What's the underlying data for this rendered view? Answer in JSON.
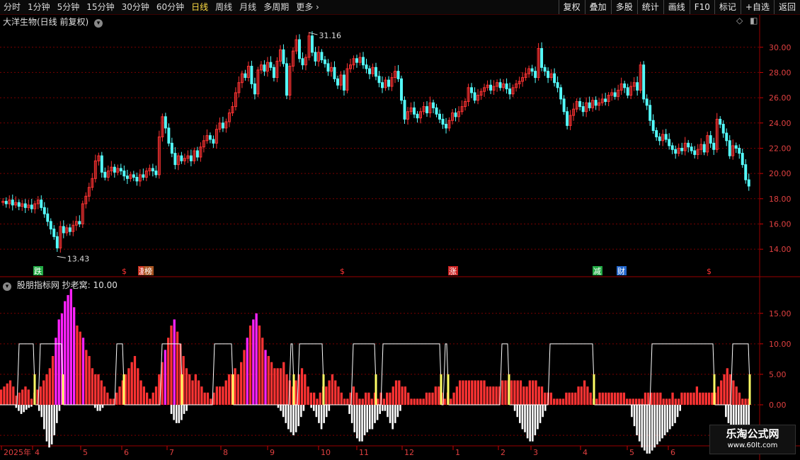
{
  "toolbar": {
    "tabs": [
      "分时",
      "1分钟",
      "5分钟",
      "15分钟",
      "30分钟",
      "60分钟",
      "日线",
      "周线",
      "月线",
      "多周期",
      "更多"
    ],
    "active_tab": "日线",
    "right_buttons": [
      "复权",
      "叠加",
      "多股",
      "统计",
      "画线",
      "F10",
      "标记",
      "+自选",
      "返回"
    ]
  },
  "main_panel": {
    "title": "大洋生物(日线 前复权)",
    "high_label": "31.16",
    "low_label": "13.43",
    "y_ticks": [
      "30.00",
      "28.00",
      "26.00",
      "24.00",
      "22.00",
      "20.00",
      "18.00",
      "16.00",
      "14.00"
    ],
    "event_tags": [
      {
        "text": "跌",
        "color": "#22aa44"
      },
      {
        "text": "$",
        "color": "#ff3333"
      },
      {
        "text": "激",
        "color": "#cc3322"
      },
      {
        "text": "榜",
        "color": "#aa5522"
      },
      {
        "text": "$",
        "color": "#ff3333"
      },
      {
        "text": "涨",
        "color": "#cc2222"
      },
      {
        "text": "减",
        "color": "#22aa44"
      },
      {
        "text": "财",
        "color": "#2266cc"
      },
      {
        "text": "$",
        "color": "#ff3333"
      }
    ]
  },
  "indicator_panel": {
    "title": "股朋指标网 抄老窝: 10.00",
    "y_ticks": [
      "15.00",
      "10.00",
      "5.00",
      "0.00",
      "-5.00"
    ]
  },
  "x_axis": {
    "labels": [
      "2025年",
      "4",
      "5",
      "6",
      "7",
      "8",
      "9",
      "10",
      "11",
      "12",
      "1",
      "2",
      "3",
      "4",
      "5",
      "6"
    ]
  },
  "watermark": {
    "line1": "乐淘公式网",
    "line2": "www.60lt.com"
  },
  "colors": {
    "up": "#ff3333",
    "down": "#54ffff",
    "grid": "#7a0000",
    "magenta": "#ff22ff",
    "yellow": "#ffff66"
  },
  "chart_data": {
    "type": "candlestick",
    "ylim": [
      13,
      31.5
    ],
    "close": [
      17.8,
      17.6,
      17.9,
      17.5,
      17.7,
      17.4,
      17.6,
      17.3,
      17.5,
      17.2,
      17.6,
      17.9,
      17.3,
      16.8,
      16.2,
      15.6,
      15.0,
      14.1,
      15.8,
      15.3,
      15.7,
      15.4,
      15.9,
      16.2,
      16.0,
      17.6,
      18.2,
      18.9,
      19.6,
      21.0,
      21.4,
      20.1,
      19.7,
      20.2,
      20.5,
      20.1,
      20.4,
      20.2,
      19.8,
      19.6,
      19.9,
      19.7,
      19.4,
      19.9,
      19.7,
      20.2,
      20.4,
      20.2,
      19.9,
      22.9,
      24.5,
      23.6,
      22.4,
      21.6,
      20.7,
      21.4,
      21.0,
      21.2,
      21.4,
      21.0,
      21.8,
      21.3,
      22.1,
      22.6,
      23.0,
      22.7,
      22.4,
      23.5,
      24.0,
      23.6,
      24.1,
      24.8,
      25.3,
      26.4,
      27.2,
      27.9,
      27.6,
      28.5,
      27.1,
      26.3,
      28.2,
      28.6,
      28.1,
      28.8,
      28.4,
      27.6,
      28.9,
      29.8,
      28.7,
      26.2,
      28.5,
      29.7,
      30.6,
      29.1,
      28.6,
      29.2,
      30.9,
      29.6,
      28.9,
      29.6,
      29.0,
      28.7,
      28.1,
      28.4,
      27.5,
      27.0,
      27.8,
      26.6,
      28.3,
      28.6,
      29.1,
      28.8,
      29.2,
      28.6,
      28.3,
      27.9,
      28.4,
      27.7,
      27.2,
      26.8,
      27.4,
      26.9,
      27.6,
      28.1,
      27.5,
      25.8,
      24.3,
      24.9,
      25.2,
      24.7,
      24.4,
      24.9,
      25.3,
      24.8,
      25.6,
      25.2,
      24.7,
      24.3,
      23.9,
      23.6,
      24.2,
      24.8,
      24.5,
      24.9,
      25.3,
      25.7,
      26.8,
      26.4,
      25.8,
      26.2,
      26.5,
      26.8,
      27.0,
      26.6,
      26.9,
      27.2,
      26.8,
      27.1,
      26.7,
      26.3,
      26.8,
      27.1,
      27.3,
      27.6,
      27.9,
      28.3,
      28.1,
      27.6,
      29.9,
      28.4,
      28.1,
      27.6,
      27.9,
      27.2,
      26.8,
      25.9,
      24.9,
      23.8,
      24.6,
      25.1,
      25.7,
      25.3,
      24.9,
      25.6,
      25.2,
      25.8,
      25.4,
      25.6,
      25.9,
      25.7,
      26.2,
      26.4,
      26.1,
      26.6,
      27.1,
      26.8,
      26.2,
      26.9,
      27.2,
      26.6,
      28.6,
      25.9,
      25.4,
      24.2,
      23.4,
      22.9,
      22.6,
      23.1,
      22.7,
      22.2,
      21.9,
      21.6,
      22.0,
      21.8,
      22.4,
      22.1,
      21.8,
      21.5,
      21.9,
      22.3,
      21.7,
      23.0,
      22.4,
      21.9,
      24.3,
      23.9,
      23.2,
      22.6,
      21.4,
      22.2,
      22.0,
      21.6,
      20.7,
      19.5,
      19.0
    ],
    "indicator": {
      "ylim": [
        -6.5,
        19.5
      ],
      "bars": [
        2.5,
        3,
        3.5,
        4,
        3,
        1.5,
        2,
        2.5,
        3,
        2.5,
        1,
        2,
        2.5,
        3,
        4,
        5,
        6,
        8,
        11,
        14,
        15,
        17,
        18,
        19,
        16,
        13,
        12,
        11,
        9,
        8,
        6,
        5,
        5,
        4,
        3,
        2,
        1,
        1,
        2,
        3,
        4,
        5,
        6,
        7,
        8,
        6,
        4,
        3,
        2,
        1,
        2,
        3,
        5,
        7,
        9,
        11,
        13,
        14,
        12,
        10,
        8,
        6,
        5,
        4,
        5,
        4,
        3,
        2,
        2,
        1,
        2,
        3,
        3,
        3,
        4,
        5,
        5,
        6,
        5,
        7,
        9,
        11,
        13,
        14,
        15,
        13,
        11,
        9,
        8,
        7,
        6,
        6,
        6,
        7,
        5,
        4,
        3,
        4,
        5,
        6,
        5,
        3,
        2,
        2,
        1,
        2,
        3,
        3,
        4,
        5,
        4,
        3,
        2,
        1,
        1,
        2,
        3,
        2,
        1,
        1,
        2,
        2,
        1,
        2,
        1,
        2,
        1,
        2,
        2,
        3,
        4,
        4,
        3,
        3,
        2,
        1,
        1,
        1,
        1,
        1,
        2,
        2,
        2,
        3,
        3,
        2,
        1,
        2,
        1,
        2,
        3,
        4,
        4,
        4,
        4,
        4,
        4,
        4,
        4,
        4,
        3,
        3,
        3,
        3,
        3,
        4,
        4,
        4,
        4,
        4,
        4,
        4,
        3,
        3,
        4,
        4,
        4,
        3,
        3,
        2,
        2,
        2,
        1,
        1,
        1,
        1,
        2,
        2,
        2,
        2,
        3,
        3,
        4,
        3,
        2,
        1,
        1,
        2,
        2,
        2,
        2,
        2,
        2,
        2,
        2,
        2,
        1,
        1,
        1,
        1,
        1,
        1,
        2,
        2,
        2,
        2,
        2,
        2,
        1,
        1,
        1,
        2,
        1,
        1,
        2,
        2,
        2,
        2,
        2,
        3,
        2,
        2,
        2,
        2,
        2,
        2,
        3,
        4,
        5,
        6,
        5,
        4,
        3,
        2,
        1,
        1,
        1
      ],
      "neg_bars": [
        0,
        0,
        0,
        0,
        0,
        0,
        0.5,
        1,
        1.5,
        1.2,
        0.8,
        0.5,
        0.3,
        0,
        0,
        1,
        2,
        4,
        6,
        7,
        6.5,
        5,
        3,
        1,
        0,
        0,
        0,
        0,
        0,
        0,
        0,
        0,
        0,
        0,
        0,
        0,
        0,
        0.5,
        1,
        1,
        0.5,
        0,
        0,
        0,
        0,
        0,
        0,
        0,
        0,
        0,
        0,
        0,
        0,
        0,
        0,
        0,
        0,
        0,
        0,
        0,
        0,
        0,
        0,
        0,
        0,
        0,
        0,
        1.5,
        2.5,
        3,
        3,
        2.5,
        1.5,
        1,
        0,
        0,
        0,
        0,
        0,
        0,
        0,
        0,
        0,
        0,
        0,
        0,
        0,
        0,
        0,
        0,
        0,
        0,
        0,
        0,
        0,
        0,
        0,
        0,
        0,
        0,
        0,
        0,
        0,
        0,
        0,
        0,
        0,
        0,
        0,
        0.5,
        1,
        2,
        3,
        4,
        4.5,
        5,
        4.5,
        3.5,
        2,
        1,
        0,
        0,
        0.5,
        1,
        2,
        3,
        4,
        3,
        2,
        1,
        0,
        0,
        0,
        0,
        0,
        0,
        0,
        1.5,
        3,
        4.5,
        5.5,
        6,
        6,
        5,
        4.5,
        4,
        4,
        3,
        2.5,
        1.5,
        1,
        1,
        2,
        3,
        4,
        3,
        2,
        1,
        0,
        0,
        0,
        0,
        0,
        0,
        0,
        0,
        0,
        0,
        0,
        0,
        0,
        0,
        0,
        0,
        0,
        0,
        0,
        0,
        0,
        0,
        0,
        0,
        0,
        0,
        0,
        0,
        0,
        0,
        0,
        0,
        0,
        0,
        0,
        0,
        0,
        0,
        0,
        0,
        0,
        0,
        0,
        0,
        1,
        2,
        3,
        4,
        4.5,
        5.5,
        6,
        6,
        5,
        4,
        3,
        2,
        1,
        0,
        0,
        0,
        0,
        0,
        0,
        0,
        0,
        0,
        0,
        0,
        0,
        0,
        0,
        0,
        0,
        0,
        0,
        0,
        0,
        0,
        0,
        0,
        0,
        0,
        0,
        0,
        0,
        0,
        0,
        0,
        0,
        0,
        2,
        3.5,
        5,
        6,
        7,
        7.5,
        8,
        8,
        7.5,
        7,
        6.5,
        6,
        5.5,
        5,
        4.5,
        4,
        3.5,
        3,
        2,
        1,
        0,
        0,
        0,
        0,
        0,
        0,
        0,
        0,
        0,
        0,
        0,
        0,
        0,
        0,
        0,
        0,
        0,
        2,
        3,
        4,
        5,
        6,
        6.5,
        6.5,
        6,
        5.5,
        5
      ]
    }
  }
}
